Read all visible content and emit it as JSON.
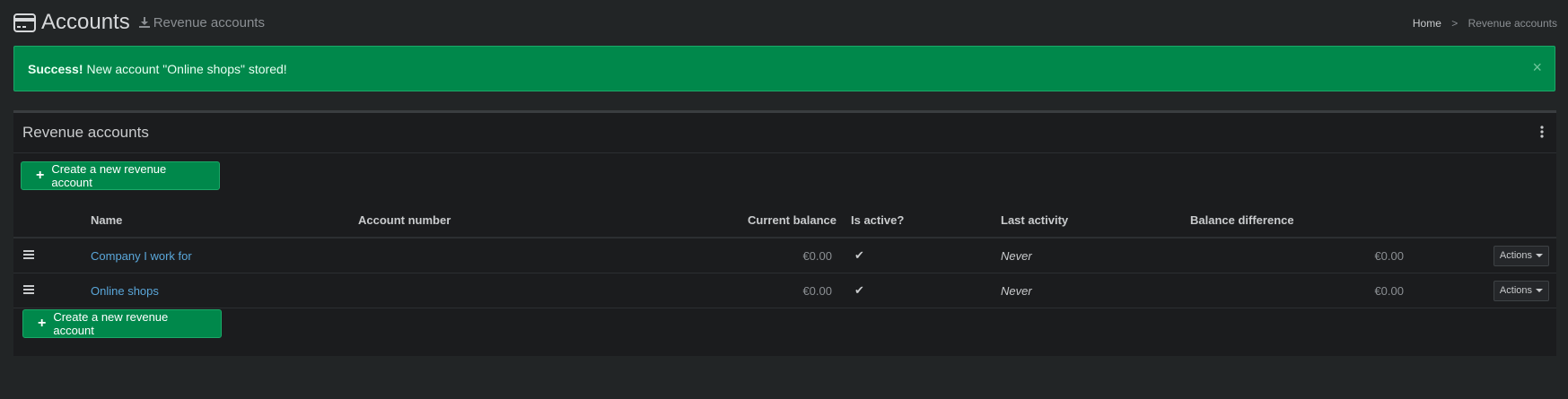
{
  "header": {
    "title": "Accounts",
    "subtitle": "Revenue accounts"
  },
  "breadcrumb": {
    "home": "Home",
    "separator": ">",
    "current": "Revenue accounts"
  },
  "alert": {
    "strong": "Success!",
    "message": "New account \"Online shops\" stored!",
    "close": "×"
  },
  "box": {
    "title": "Revenue accounts",
    "create_top_label": "Create a new revenue account",
    "create_bottom_label": "Create a new revenue account"
  },
  "table": {
    "columns": {
      "name": "Name",
      "account_number": "Account number",
      "current_balance": "Current balance",
      "is_active": "Is active?",
      "last_activity": "Last activity",
      "balance_difference": "Balance difference"
    },
    "rows": [
      {
        "name": "Company I work for",
        "account_number": "",
        "current_balance": "€0.00",
        "is_active": "✔",
        "last_activity": "Never",
        "balance_difference": "€0.00",
        "actions": "Actions"
      },
      {
        "name": "Online shops",
        "account_number": "",
        "current_balance": "€0.00",
        "is_active": "✔",
        "last_activity": "Never",
        "balance_difference": "€0.00",
        "actions": "Actions"
      }
    ]
  },
  "colors": {
    "background": "#222526",
    "success": "#00884b",
    "link": "#5aa7da"
  },
  "icons": {
    "header": "credit-card-icon",
    "subtitle": "download-icon",
    "menu": "kebab-menu-icon",
    "drag": "hamburger-icon",
    "active": "check-icon"
  }
}
